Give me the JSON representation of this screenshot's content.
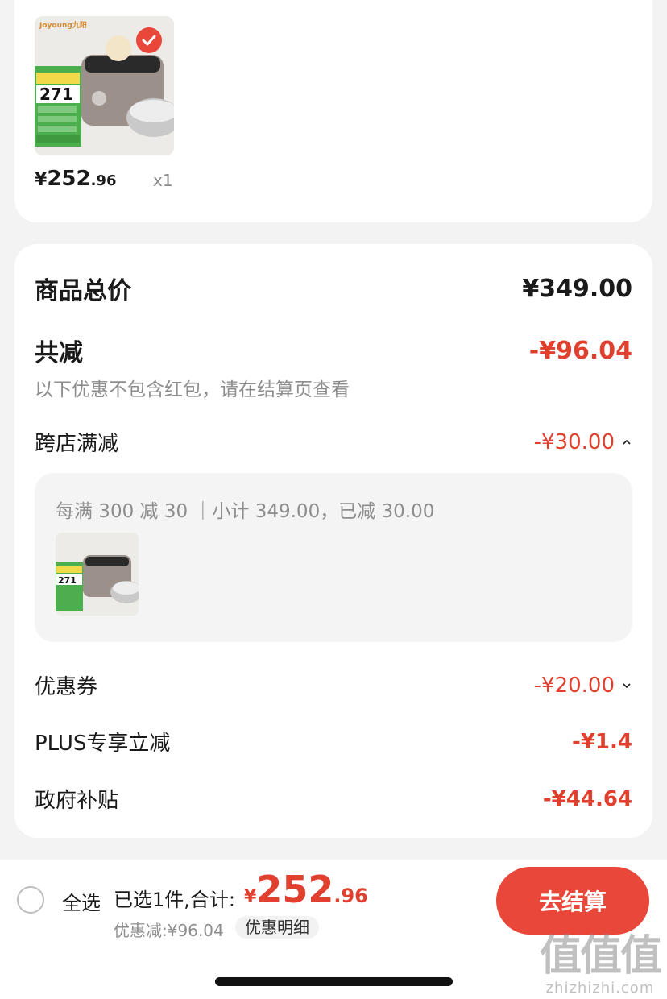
{
  "product": {
    "brand": "Joyoung九阳",
    "thumb_promo_price": "271",
    "price_symbol": "¥",
    "price_int": "252",
    "price_dec": ".96",
    "quantity": "x1"
  },
  "summary": {
    "total_label": "商品总价",
    "total_value": "¥349.00",
    "reduce_label": "共减",
    "reduce_value": "-¥96.04",
    "note": "以下优惠不包含红包，请在结算页查看",
    "items": [
      {
        "label": "跨店满减",
        "value": "-¥30.00"
      },
      {
        "label": "优惠券",
        "value": "-¥20.00"
      },
      {
        "label": "PLUS专享立减",
        "value": "-¥1.4"
      },
      {
        "label": "政府补贴",
        "value": "-¥44.64"
      }
    ],
    "promo_detail": "每满 300 减 30 ｜小计 349.00，已减 30.00"
  },
  "bottom": {
    "select_all": "全选",
    "selected_count": "已选1件,合计:",
    "total_symbol": "¥",
    "total_int": "252",
    "total_dec": ".96",
    "discount_line": "优惠减:¥96.04",
    "detail_tag": "优惠明细",
    "checkout": "去结算"
  },
  "watermark": {
    "big": "值值值",
    "small": "zhizhizhi.com"
  },
  "colors": {
    "accent": "#e8473a",
    "discount_red": "#e2402f"
  }
}
